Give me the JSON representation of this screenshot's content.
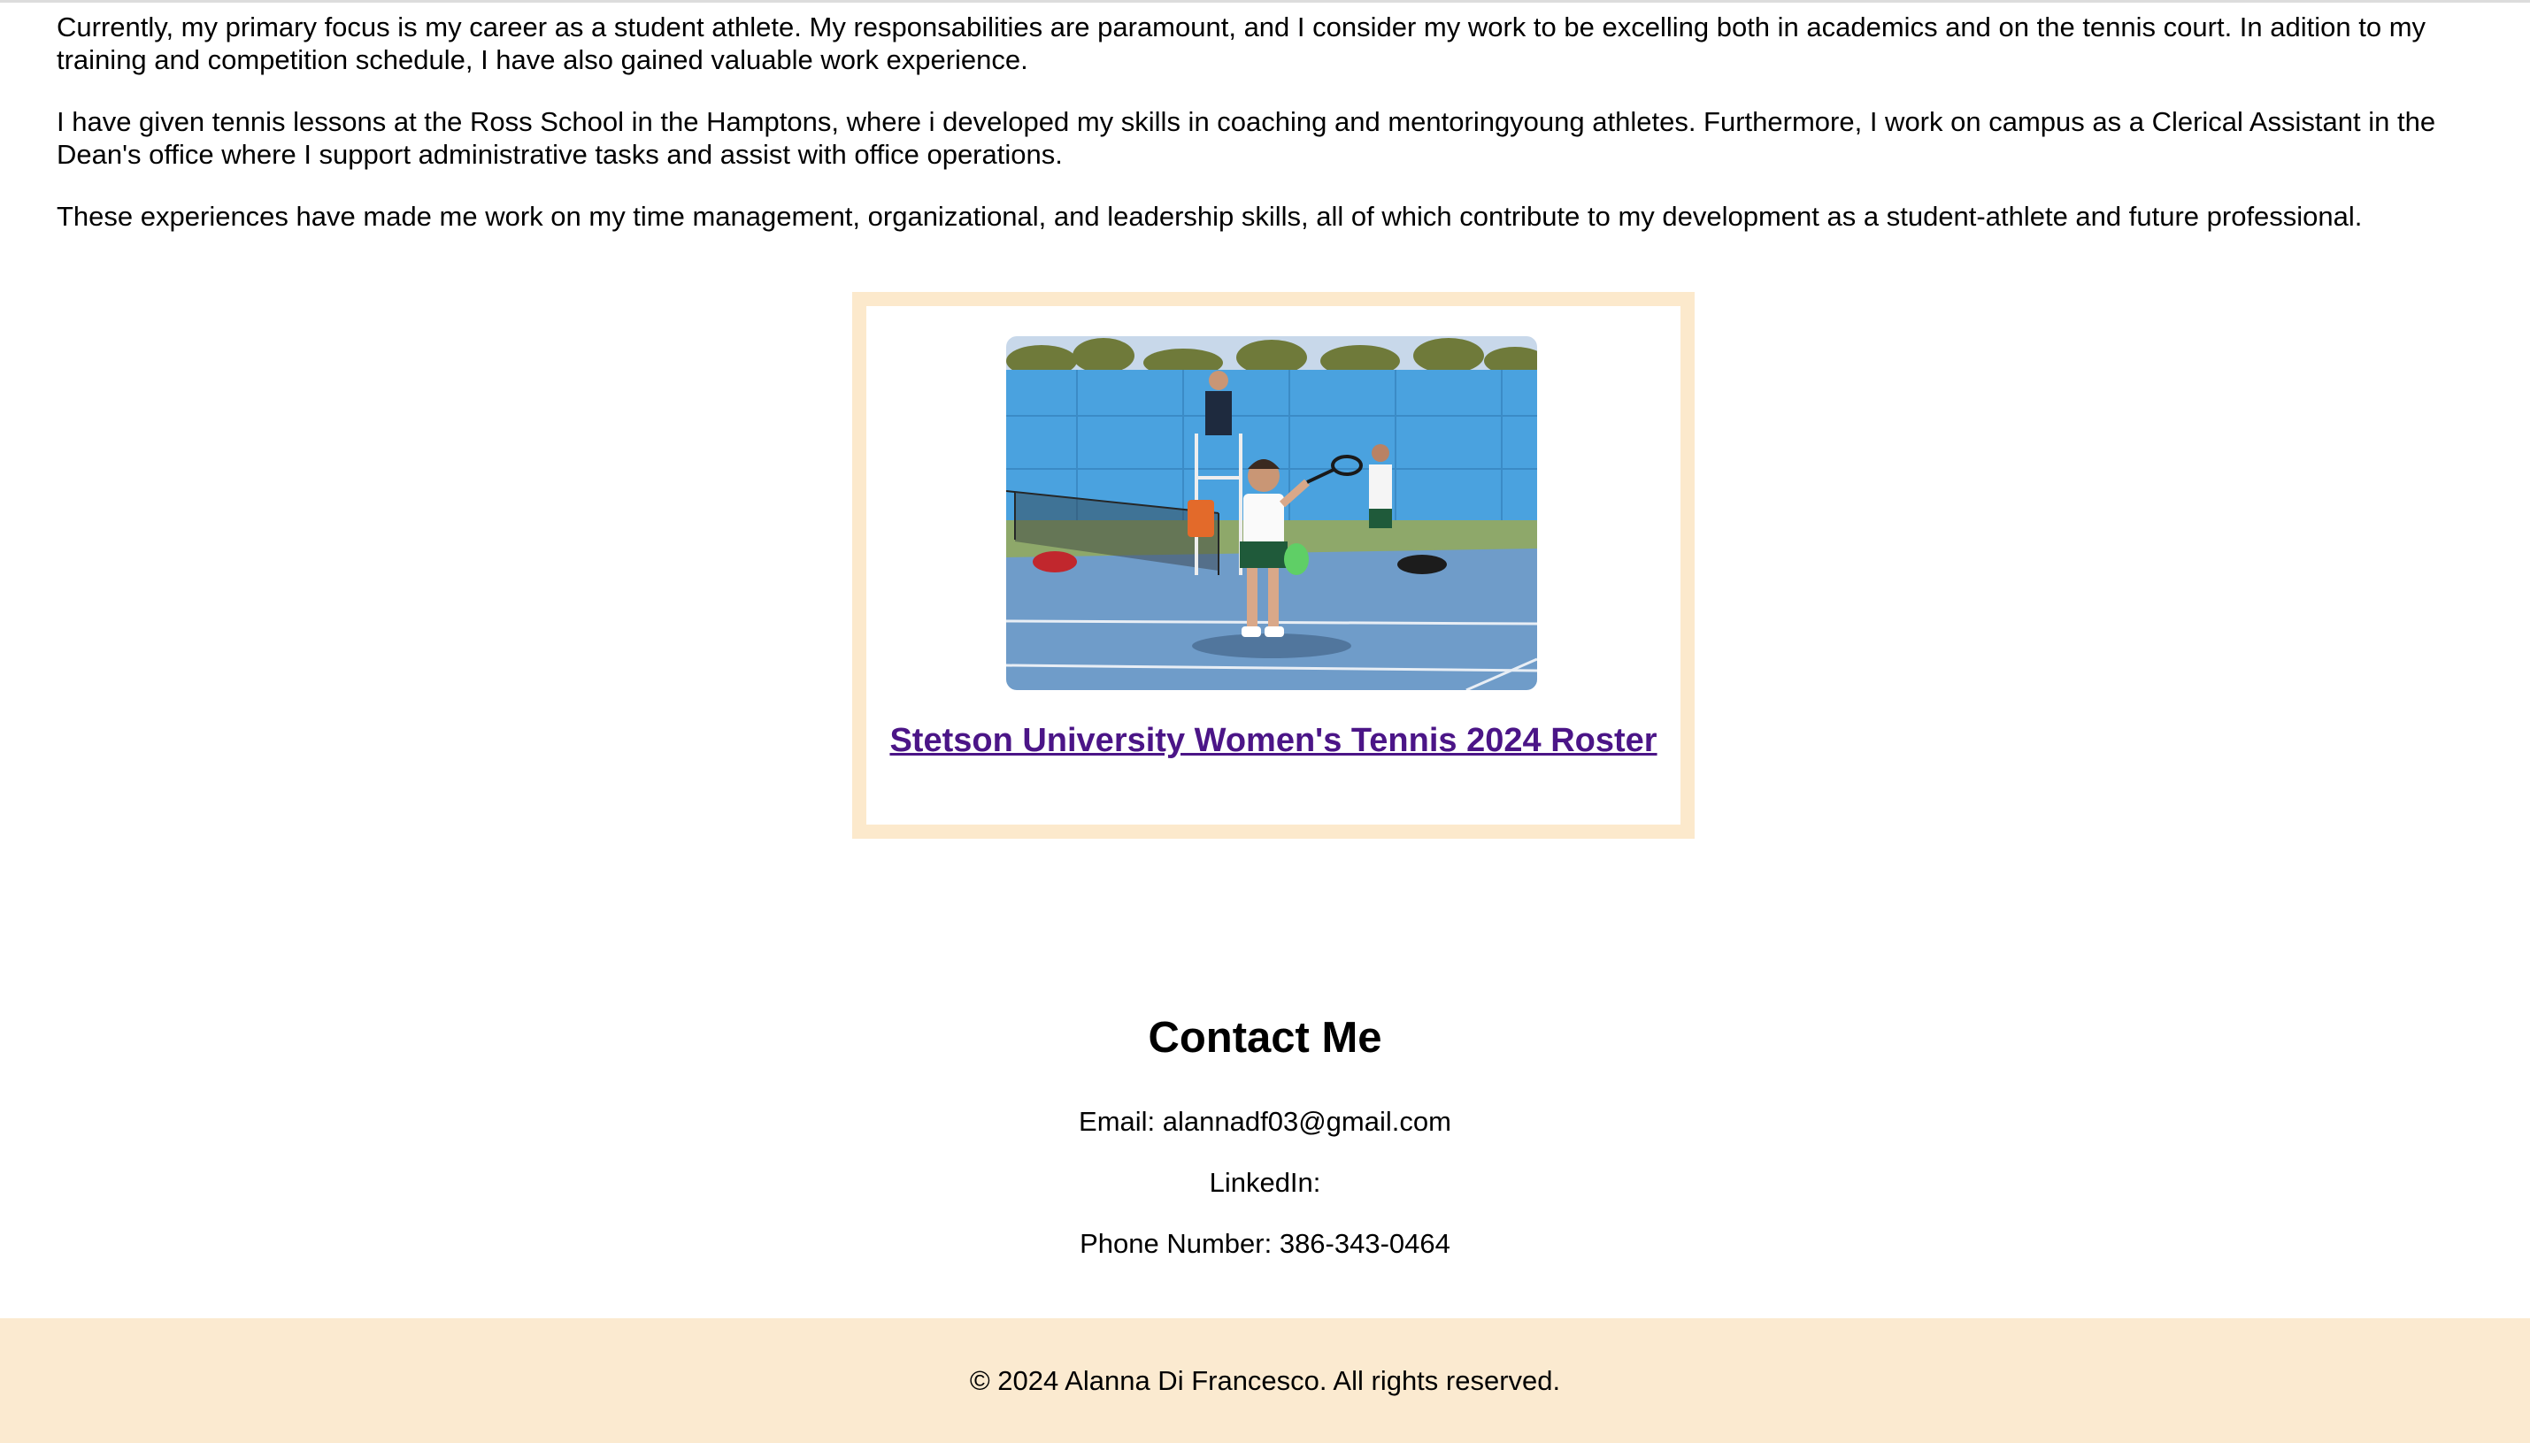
{
  "about": {
    "paragraphs": [
      "Currently, my primary focus is my career as a student athlete. My responsabilities are paramount, and I consider my work to be excelling both in academics and on the tennis court. In adition to my training and competition schedule, I have also gained valuable work experience.",
      "I have given tennis lessons at the Ross School in the Hamptons, where i developed my skills in coaching and mentoringyoung athletes. Furthermore, I work on campus as a Clerical Assistant in the Dean's office where I support administrative tasks and assist with office operations.",
      "These experiences have made me work on my time management, organizational, and leadership skills, all of which contribute to my development as a student-athlete and future professional."
    ]
  },
  "roster_card": {
    "image_icon": "tennis-player-photo",
    "link_text": "Stetson University Women's Tennis 2024 Roster",
    "link_color": "#4b1587",
    "frame_color": "#fce9cc"
  },
  "contact": {
    "heading": "Contact Me",
    "email": "Email: alannadf03@gmail.com",
    "linkedin": "LinkedIn:",
    "phone": "Phone Number: 386-343-0464"
  },
  "footer": {
    "text": "© 2024 Alanna Di Francesco. All rights reserved.",
    "background": "#fbead0"
  }
}
